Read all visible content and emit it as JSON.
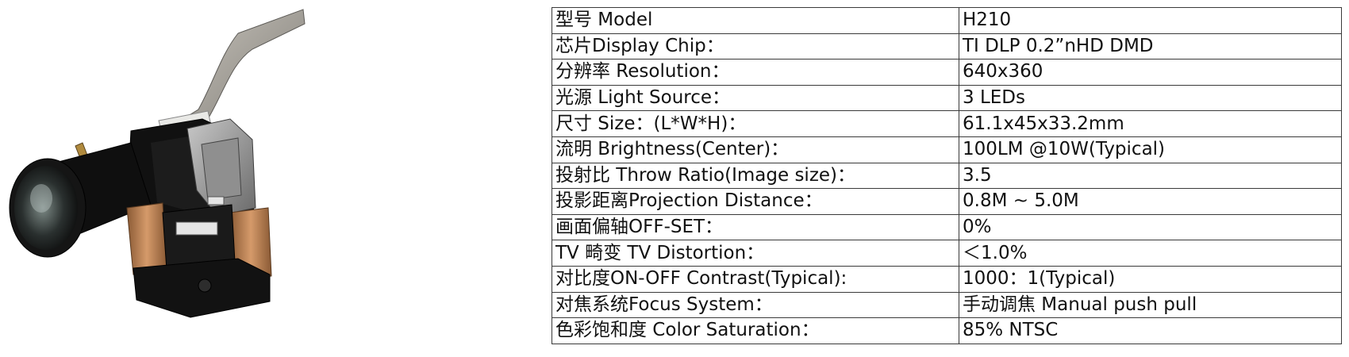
{
  "specs": [
    {
      "label": "型号 Model",
      "value": "H210"
    },
    {
      "label": "芯片Display Chip：",
      "value": "TI DLP 0.2”nHD DMD"
    },
    {
      "label": "分辨率  Resolution：",
      "value": "640x360"
    },
    {
      "label": "光源 Light Source：",
      "value": "3 LEDs"
    },
    {
      "label": "尺寸 Size：(L*W*H)：",
      "value": "61.1x45x33.2mm"
    },
    {
      "label": "流明 Brightness(Center)：",
      "value": "100LM @10W(Typical)"
    },
    {
      "label": "投射比 Throw Ratio(Image size)：",
      "value": "3.5"
    },
    {
      "label": "投影距离Projection Distance：",
      "value": "0.8M ~ 5.0M"
    },
    {
      "label": "画面偏轴OFF-SET：",
      "value": "0%"
    },
    {
      "label": "TV 畸变 TV Distortion：",
      "value": "＜1.0%"
    },
    {
      "label": "对比度ON-OFF Contrast(Typical):",
      "value": "1000：1(Typical)"
    },
    {
      "label": "对焦系统Focus System：",
      "value": "手动调焦 Manual push pull"
    },
    {
      "label": "色彩饱和度 Color Saturation：",
      "value": "85% NTSC"
    }
  ]
}
